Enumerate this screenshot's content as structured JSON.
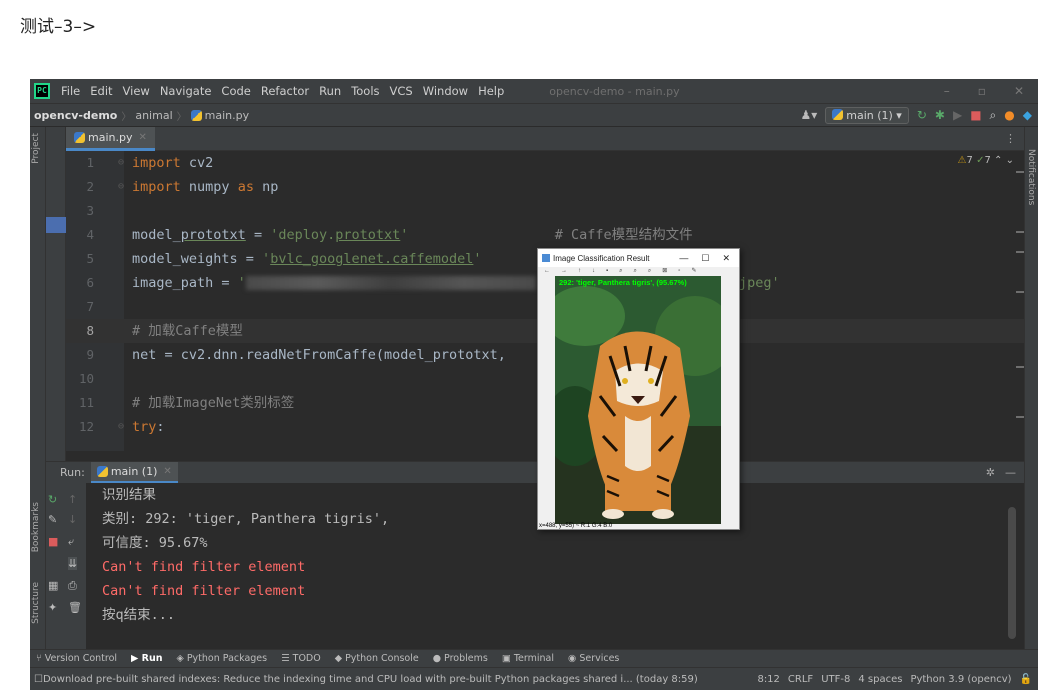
{
  "page_caption": "测试–3–>",
  "menubar": {
    "items": [
      "File",
      "Edit",
      "View",
      "Navigate",
      "Code",
      "Refactor",
      "Run",
      "Tools",
      "VCS",
      "Window",
      "Help"
    ],
    "window_title": "opencv-demo - main.py"
  },
  "navbar": {
    "project": "opencv-demo",
    "folder": "animal",
    "file": "main.py",
    "run_config": "main (1)"
  },
  "side_labels": {
    "project": "Project",
    "bookmarks": "Bookmarks",
    "structure": "Structure",
    "notifications": "Notifications"
  },
  "editor": {
    "tab": "main.py",
    "inspections": {
      "warnings": "7",
      "ok": "7"
    },
    "lines": [
      {
        "n": "1",
        "tokens": [
          [
            "kw",
            "import"
          ],
          [
            "plain",
            " cv2"
          ]
        ]
      },
      {
        "n": "2",
        "tokens": [
          [
            "kw",
            "import"
          ],
          [
            "plain",
            " numpy "
          ],
          [
            "kw",
            "as"
          ],
          [
            "plain",
            " np"
          ]
        ]
      },
      {
        "n": "3",
        "tokens": []
      },
      {
        "n": "4",
        "tokens": [
          [
            "plain",
            "model_"
          ],
          [
            "underline",
            "prototxt"
          ],
          [
            "plain",
            " = "
          ],
          [
            "str",
            "'deploy."
          ],
          [
            "strunder",
            "prototxt"
          ],
          [
            "str",
            "'"
          ],
          [
            "plain",
            "                  "
          ],
          [
            "cmt",
            "# Caffe模型结构文件"
          ]
        ]
      },
      {
        "n": "5",
        "tokens": [
          [
            "plain",
            "model_weights = "
          ],
          [
            "str",
            "'"
          ],
          [
            "strunder",
            "bvlc_googlenet.caffemodel"
          ],
          [
            "str",
            "'"
          ]
        ]
      },
      {
        "n": "6",
        "tokens": [
          [
            "plain",
            "image_path = "
          ],
          [
            "str",
            "'"
          ],
          [
            "blur",
            ""
          ],
          [
            "plain",
            "                      "
          ],
          [
            "str",
            "_2.jpeg'"
          ]
        ]
      },
      {
        "n": "7",
        "tokens": []
      },
      {
        "n": "8",
        "tokens": [
          [
            "cmt",
            "# 加载Caffe模型"
          ]
        ]
      },
      {
        "n": "9",
        "tokens": [
          [
            "plain",
            "net = cv2.dnn.readNetFromCaffe(model_prototxt, "
          ]
        ]
      },
      {
        "n": "10",
        "tokens": []
      },
      {
        "n": "11",
        "tokens": [
          [
            "cmt",
            "# 加载ImageNet类别标签"
          ]
        ]
      },
      {
        "n": "12",
        "tokens": [
          [
            "kw",
            "try"
          ],
          [
            "plain",
            ":"
          ]
        ]
      }
    ]
  },
  "run": {
    "label": "Run:",
    "tab": "main (1)",
    "output": [
      {
        "text": "识别结果",
        "type": "normal"
      },
      {
        "text": "类别: 292: 'tiger, Panthera tigris',",
        "type": "normal"
      },
      {
        "text": "可信度: 95.67%",
        "type": "normal"
      },
      {
        "text": "Can't find filter element",
        "type": "error"
      },
      {
        "text": "Can't find filter element",
        "type": "error"
      },
      {
        "text": "按q结束...",
        "type": "normal"
      }
    ]
  },
  "toolwindows": [
    "Version Control",
    "Run",
    "Python Packages",
    "TODO",
    "Python Console",
    "Problems",
    "Terminal",
    "Services"
  ],
  "status": {
    "message": "Download pre-built shared indexes: Reduce the indexing time and CPU load with pre-built Python packages shared i... (today 8:59)",
    "position": "8:12",
    "line_sep": "CRLF",
    "encoding": "UTF-8",
    "indent": "4 spaces",
    "interpreter": "Python 3.9 (opencv)"
  },
  "image_window": {
    "title": "Image Classification Result",
    "result_text": "292: 'tiger, Panthera tigris', (95.67%)",
    "status_text": "x=488, y=55) ~ R:1 G:4 B:0"
  },
  "colors": {
    "accent": "#4a88c7",
    "keyword": "#cc7832",
    "string": "#6a8759",
    "comment": "#808080",
    "error": "#ff6b68",
    "label_green": "#00ff00"
  }
}
